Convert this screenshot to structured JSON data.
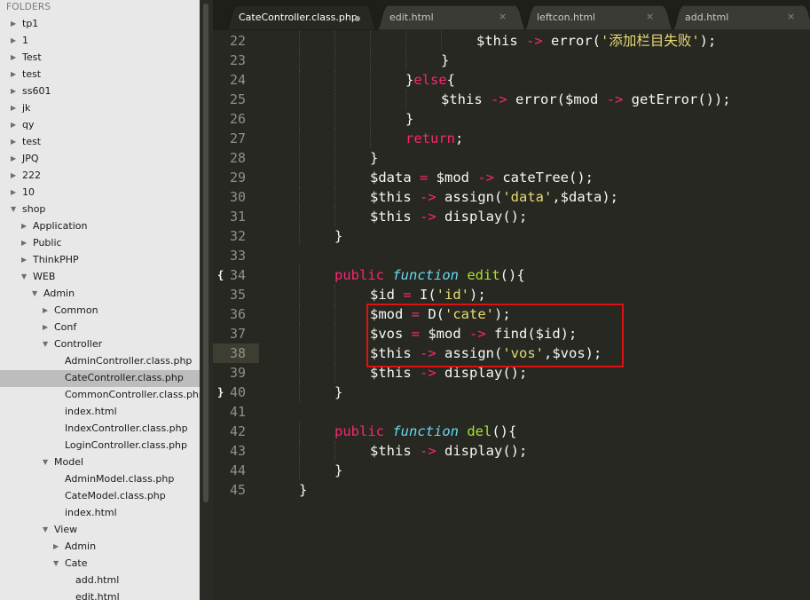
{
  "sidebar": {
    "header": "FOLDERS",
    "items": [
      {
        "label": "tp1",
        "depth": 0,
        "type": "folder",
        "open": false
      },
      {
        "label": "1",
        "depth": 0,
        "type": "folder",
        "open": false
      },
      {
        "label": "Test",
        "depth": 0,
        "type": "folder",
        "open": false
      },
      {
        "label": "test",
        "depth": 0,
        "type": "folder",
        "open": false
      },
      {
        "label": "ss601",
        "depth": 0,
        "type": "folder",
        "open": false
      },
      {
        "label": "jk",
        "depth": 0,
        "type": "folder",
        "open": false
      },
      {
        "label": "qy",
        "depth": 0,
        "type": "folder",
        "open": false
      },
      {
        "label": "test",
        "depth": 0,
        "type": "folder",
        "open": false
      },
      {
        "label": "JPQ",
        "depth": 0,
        "type": "folder",
        "open": false
      },
      {
        "label": "222",
        "depth": 0,
        "type": "folder",
        "open": false
      },
      {
        "label": "10",
        "depth": 0,
        "type": "folder",
        "open": false
      },
      {
        "label": "shop",
        "depth": 0,
        "type": "folder",
        "open": true
      },
      {
        "label": "Application",
        "depth": 1,
        "type": "folder",
        "open": false
      },
      {
        "label": "Public",
        "depth": 1,
        "type": "folder",
        "open": false
      },
      {
        "label": "ThinkPHP",
        "depth": 1,
        "type": "folder",
        "open": false
      },
      {
        "label": "WEB",
        "depth": 1,
        "type": "folder",
        "open": true
      },
      {
        "label": "Admin",
        "depth": 2,
        "type": "folder",
        "open": true
      },
      {
        "label": "Common",
        "depth": 3,
        "type": "folder",
        "open": false
      },
      {
        "label": "Conf",
        "depth": 3,
        "type": "folder",
        "open": false
      },
      {
        "label": "Controller",
        "depth": 3,
        "type": "folder",
        "open": true
      },
      {
        "label": "AdminController.class.php",
        "depth": 4,
        "type": "file"
      },
      {
        "label": "CateController.class.php",
        "depth": 4,
        "type": "file",
        "selected": true
      },
      {
        "label": "CommonController.class.php",
        "depth": 4,
        "type": "file"
      },
      {
        "label": "index.html",
        "depth": 4,
        "type": "file"
      },
      {
        "label": "IndexController.class.php",
        "depth": 4,
        "type": "file"
      },
      {
        "label": "LoginController.class.php",
        "depth": 4,
        "type": "file"
      },
      {
        "label": "Model",
        "depth": 3,
        "type": "folder",
        "open": true
      },
      {
        "label": "AdminModel.class.php",
        "depth": 4,
        "type": "file"
      },
      {
        "label": "CateModel.class.php",
        "depth": 4,
        "type": "file"
      },
      {
        "label": "index.html",
        "depth": 4,
        "type": "file"
      },
      {
        "label": "View",
        "depth": 3,
        "type": "folder",
        "open": true
      },
      {
        "label": "Admin",
        "depth": 4,
        "type": "folder",
        "open": false
      },
      {
        "label": "Cate",
        "depth": 4,
        "type": "folder",
        "open": true
      },
      {
        "label": "add.html",
        "depth": 5,
        "type": "file"
      },
      {
        "label": "edit.html",
        "depth": 5,
        "type": "file"
      }
    ]
  },
  "tabs": [
    {
      "label": "CateController.class.php",
      "active": true,
      "modified": true
    },
    {
      "label": "edit.html",
      "active": false,
      "close": "×"
    },
    {
      "label": "leftcon.html",
      "active": false,
      "close": "×"
    },
    {
      "label": "add.html",
      "active": false,
      "close": "×"
    }
  ],
  "editor": {
    "current_line": "38",
    "lines": [
      {
        "num": "22",
        "indent": 24,
        "tokens": [
          [
            "$this ",
            ""
          ],
          [
            "->",
            "k"
          ],
          [
            " error(",
            ""
          ],
          [
            "'添加栏目失败'",
            "s"
          ],
          [
            ");",
            ""
          ]
        ]
      },
      {
        "num": "23",
        "indent": 20,
        "tokens": [
          [
            "}",
            ""
          ]
        ]
      },
      {
        "num": "24",
        "indent": 16,
        "tokens": [
          [
            "}",
            ""
          ],
          [
            "else",
            "k"
          ],
          [
            "{",
            ""
          ]
        ]
      },
      {
        "num": "25",
        "indent": 20,
        "tokens": [
          [
            "$this ",
            ""
          ],
          [
            "->",
            "k"
          ],
          [
            " error($mod ",
            ""
          ],
          [
            "->",
            "k"
          ],
          [
            " getError());",
            ""
          ]
        ]
      },
      {
        "num": "26",
        "indent": 16,
        "tokens": [
          [
            "}",
            ""
          ]
        ]
      },
      {
        "num": "27",
        "indent": 16,
        "tokens": [
          [
            "return",
            "k"
          ],
          [
            ";",
            ""
          ]
        ]
      },
      {
        "num": "28",
        "indent": 12,
        "tokens": [
          [
            "}",
            ""
          ]
        ]
      },
      {
        "num": "29",
        "indent": 12,
        "tokens": [
          [
            "$data ",
            ""
          ],
          [
            "=",
            "k"
          ],
          [
            " $mod ",
            ""
          ],
          [
            "->",
            "k"
          ],
          [
            " cateTree();",
            ""
          ]
        ]
      },
      {
        "num": "30",
        "indent": 12,
        "tokens": [
          [
            "$this ",
            ""
          ],
          [
            "->",
            "k"
          ],
          [
            " assign(",
            ""
          ],
          [
            "'data'",
            "s"
          ],
          [
            ",$data);",
            ""
          ]
        ]
      },
      {
        "num": "31",
        "indent": 12,
        "tokens": [
          [
            "$this ",
            ""
          ],
          [
            "->",
            "k"
          ],
          [
            " display();",
            ""
          ]
        ]
      },
      {
        "num": "32",
        "indent": 8,
        "tokens": [
          [
            "}",
            ""
          ]
        ]
      },
      {
        "num": "33",
        "indent": 0,
        "tokens": []
      },
      {
        "num": "34",
        "indent": 8,
        "fold": "{",
        "tokens": [
          [
            "public ",
            "k"
          ],
          [
            "function",
            "f"
          ],
          [
            " ",
            ""
          ],
          [
            "edit",
            "n"
          ],
          [
            "(){",
            ""
          ]
        ]
      },
      {
        "num": "35",
        "indent": 12,
        "tokens": [
          [
            "$id ",
            ""
          ],
          [
            "=",
            "k"
          ],
          [
            " I(",
            ""
          ],
          [
            "'id'",
            "s"
          ],
          [
            ");",
            ""
          ]
        ]
      },
      {
        "num": "36",
        "indent": 12,
        "tokens": [
          [
            "$mod ",
            ""
          ],
          [
            "=",
            "k"
          ],
          [
            " D(",
            ""
          ],
          [
            "'cate'",
            "s"
          ],
          [
            ");",
            ""
          ]
        ]
      },
      {
        "num": "37",
        "indent": 12,
        "tokens": [
          [
            "$vos ",
            ""
          ],
          [
            "=",
            "k"
          ],
          [
            " $mod ",
            ""
          ],
          [
            "->",
            "k"
          ],
          [
            " find($id);",
            ""
          ]
        ]
      },
      {
        "num": "38",
        "indent": 12,
        "tokens": [
          [
            "$this ",
            ""
          ],
          [
            "->",
            "k"
          ],
          [
            " assign(",
            ""
          ],
          [
            "'vos'",
            "s"
          ],
          [
            ",$vos);",
            ""
          ]
        ]
      },
      {
        "num": "39",
        "indent": 12,
        "tokens": [
          [
            "$this ",
            ""
          ],
          [
            "->",
            "k"
          ],
          [
            " display();",
            ""
          ]
        ]
      },
      {
        "num": "40",
        "indent": 8,
        "fold": "}",
        "tokens": [
          [
            "}",
            ""
          ]
        ]
      },
      {
        "num": "41",
        "indent": 0,
        "tokens": []
      },
      {
        "num": "42",
        "indent": 8,
        "tokens": [
          [
            "public ",
            "k"
          ],
          [
            "function",
            "f"
          ],
          [
            " ",
            ""
          ],
          [
            "del",
            "n"
          ],
          [
            "(){",
            ""
          ]
        ]
      },
      {
        "num": "43",
        "indent": 12,
        "tokens": [
          [
            "$this ",
            ""
          ],
          [
            "->",
            "k"
          ],
          [
            " display();",
            ""
          ]
        ]
      },
      {
        "num": "44",
        "indent": 8,
        "tokens": [
          [
            "}",
            ""
          ]
        ]
      },
      {
        "num": "45",
        "indent": 4,
        "tokens": [
          [
            "}",
            ""
          ]
        ]
      }
    ]
  },
  "highlight_box": {
    "from_line": "36",
    "to_line": "38",
    "color": "#e01010"
  },
  "colors": {
    "background": "#272822",
    "keyword": "#f92672",
    "storage": "#66d9ef",
    "function_name": "#a6e22e",
    "string": "#e6db74",
    "sidebar_bg": "#e8e8e8",
    "selected_row": "#bdbdbd"
  }
}
